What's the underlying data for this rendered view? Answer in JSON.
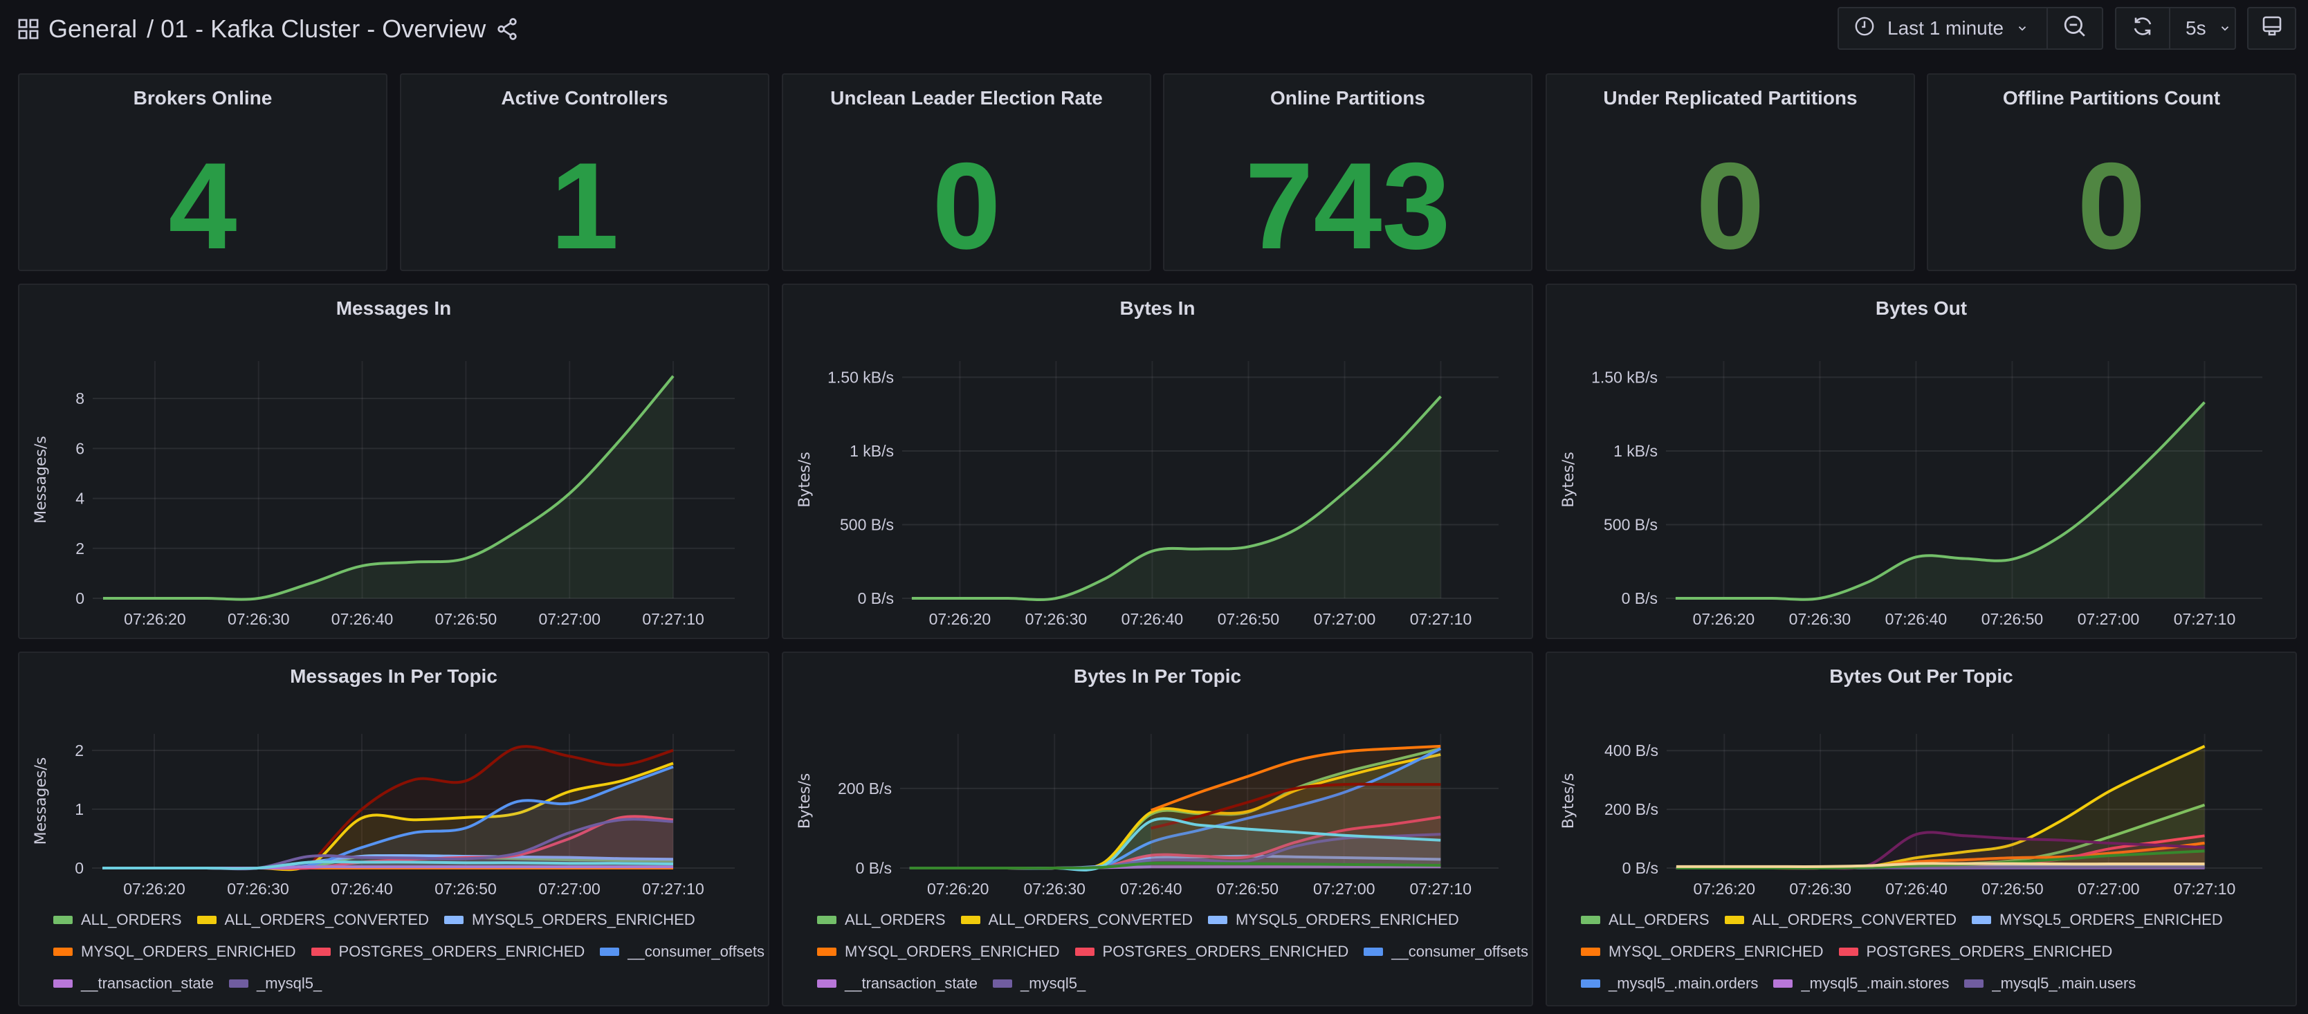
{
  "header": {
    "folder": "General",
    "title": "/ 01 - Kafka Cluster - Overview",
    "time_range": "Last 1 minute",
    "refresh_interval": "5s",
    "icons": [
      "dashboard-grid-icon",
      "share-icon",
      "clock-icon",
      "chevron-down-icon",
      "zoom-out-icon",
      "refresh-icon",
      "monitor-icon"
    ]
  },
  "colors": {
    "stat_green": "#299c46",
    "stat_green_dim": "#508642",
    "background": "#111217",
    "panel": "#181b1f"
  },
  "stats": [
    {
      "title": "Brokers Online",
      "value": "4",
      "color": "#299c46"
    },
    {
      "title": "Active Controllers",
      "value": "1",
      "color": "#299c46"
    },
    {
      "title": "Unclean Leader Election Rate",
      "value": "0",
      "color": "#299c46"
    },
    {
      "title": "Online Partitions",
      "value": "743",
      "color": "#299c46"
    },
    {
      "title": "Under Replicated Partitions",
      "value": "0",
      "color": "#508642"
    },
    {
      "title": "Offline Partitions Count",
      "value": "0",
      "color": "#508642"
    }
  ],
  "chart_data": [
    {
      "type": "line",
      "title": "Messages In",
      "ylabel": "Messages/s",
      "x": [
        "07:26:15",
        "07:26:20",
        "07:26:25",
        "07:26:30",
        "07:26:35",
        "07:26:40",
        "07:26:45",
        "07:26:50",
        "07:26:55",
        "07:27:00",
        "07:27:05",
        "07:27:10"
      ],
      "xlim": [
        "07:26:14",
        "07:27:15"
      ],
      "xticks": [
        "07:26:20",
        "07:26:30",
        "07:26:40",
        "07:26:50",
        "07:27:00",
        "07:27:10"
      ],
      "ylim": [
        0,
        9.5
      ],
      "yticks": [
        {
          "v": 0,
          "label": "0"
        },
        {
          "v": 2,
          "label": "2"
        },
        {
          "v": 4,
          "label": "4"
        },
        {
          "v": 6,
          "label": "6"
        },
        {
          "v": 8,
          "label": "8"
        }
      ],
      "grid": true,
      "series": [
        {
          "color": "#73bf69",
          "values": [
            0,
            0,
            0,
            0,
            0.6,
            1.3,
            1.45,
            1.6,
            2.7,
            4.2,
            6.4,
            8.9
          ]
        }
      ]
    },
    {
      "type": "line",
      "title": "Bytes In",
      "ylabel": "Bytes/s",
      "x": [
        "07:26:15",
        "07:26:20",
        "07:26:25",
        "07:26:30",
        "07:26:35",
        "07:26:40",
        "07:26:45",
        "07:26:50",
        "07:26:55",
        "07:27:00",
        "07:27:05",
        "07:27:10"
      ],
      "xlim": [
        "07:26:14",
        "07:27:15"
      ],
      "xticks": [
        "07:26:20",
        "07:26:30",
        "07:26:40",
        "07:26:50",
        "07:27:00",
        "07:27:10"
      ],
      "ylim": [
        0,
        1610
      ],
      "yticks": [
        {
          "v": 0,
          "label": "0 B/s"
        },
        {
          "v": 500,
          "label": "500 B/s"
        },
        {
          "v": 1000,
          "label": "1 kB/s"
        },
        {
          "v": 1500,
          "label": "1.50 kB/s"
        }
      ],
      "grid": true,
      "series": [
        {
          "color": "#73bf69",
          "values": [
            0,
            0,
            0,
            0,
            130,
            320,
            335,
            350,
            470,
            720,
            1020,
            1370
          ]
        }
      ]
    },
    {
      "type": "line",
      "title": "Bytes Out",
      "ylabel": "Bytes/s",
      "x": [
        "07:26:15",
        "07:26:20",
        "07:26:25",
        "07:26:30",
        "07:26:35",
        "07:26:40",
        "07:26:45",
        "07:26:50",
        "07:26:55",
        "07:27:00",
        "07:27:05",
        "07:27:10"
      ],
      "xlim": [
        "07:26:14",
        "07:27:15"
      ],
      "xticks": [
        "07:26:20",
        "07:26:30",
        "07:26:40",
        "07:26:50",
        "07:27:00",
        "07:27:10"
      ],
      "ylim": [
        0,
        1610
      ],
      "yticks": [
        {
          "v": 0,
          "label": "0 B/s"
        },
        {
          "v": 500,
          "label": "500 B/s"
        },
        {
          "v": 1000,
          "label": "1 kB/s"
        },
        {
          "v": 1500,
          "label": "1.50 kB/s"
        }
      ],
      "grid": true,
      "series": [
        {
          "color": "#73bf69",
          "values": [
            0,
            0,
            0,
            0,
            110,
            280,
            270,
            265,
            420,
            680,
            990,
            1330
          ]
        }
      ]
    },
    {
      "type": "line",
      "title": "Messages In Per Topic",
      "ylabel": "Messages/s",
      "legend": "bottom",
      "x": [
        "07:26:15",
        "07:26:20",
        "07:26:25",
        "07:26:30",
        "07:26:35",
        "07:26:40",
        "07:26:45",
        "07:26:50",
        "07:26:55",
        "07:27:00",
        "07:27:05",
        "07:27:10"
      ],
      "xlim": [
        "07:26:14",
        "07:27:15"
      ],
      "xticks": [
        "07:26:20",
        "07:26:30",
        "07:26:40",
        "07:26:50",
        "07:27:00",
        "07:27:10"
      ],
      "ylim": [
        0,
        2.28
      ],
      "yticks": [
        {
          "v": 0,
          "label": "0"
        },
        {
          "v": 1,
          "label": "1"
        },
        {
          "v": 2,
          "label": "2"
        }
      ],
      "grid": true,
      "series": [
        {
          "color": "#890f02",
          "values": [
            null,
            null,
            null,
            null,
            0.05,
            1.0,
            1.5,
            1.48,
            2.05,
            1.9,
            1.75,
            2.0
          ]
        },
        {
          "name": "ALL_ORDERS",
          "color": "#73bf69",
          "values": [
            0,
            0,
            0,
            0,
            0.02,
            0.2,
            0.19,
            0.18,
            0.16,
            0.14,
            0.13,
            0.12
          ]
        },
        {
          "name": "ALL_ORDERS_CONVERTED",
          "color": "#f2cc0c",
          "values": [
            0,
            0,
            0,
            0,
            0.05,
            0.85,
            0.82,
            0.86,
            0.93,
            1.3,
            1.48,
            1.78
          ]
        },
        {
          "name": "MYSQL5_ORDERS_ENRICHED",
          "color": "#8ab8ff",
          "values": [
            0,
            0,
            0,
            0,
            0.1,
            0.2,
            0.21,
            0.2,
            0.19,
            0.18,
            0.16,
            0.15
          ]
        },
        {
          "name": "MYSQL_ORDERS_ENRICHED",
          "color": "#ff780a",
          "values": [
            0,
            0,
            0,
            0,
            0,
            0,
            0,
            0,
            0,
            0,
            0,
            0
          ]
        },
        {
          "name": "POSTGRES_ORDERS_ENRICHED",
          "color": "#f2495c",
          "values": [
            0,
            0,
            0,
            0,
            0,
            0.1,
            0.15,
            0.18,
            0.22,
            0.5,
            0.86,
            0.82
          ]
        },
        {
          "name": "__consumer_offsets",
          "color": "#5794f2",
          "values": [
            0,
            0,
            0,
            0,
            0.05,
            0.35,
            0.6,
            0.68,
            1.13,
            1.1,
            1.4,
            1.72
          ]
        },
        {
          "name": "__transaction_state",
          "color": "#b877d9",
          "values": [
            0,
            0,
            0,
            0,
            0.02,
            0.02,
            0.02,
            0.02,
            0.02,
            0.02,
            0.02,
            0.02
          ]
        },
        {
          "name": "_mysql5_",
          "color": "#705da0",
          "values": [
            0,
            0,
            0,
            0,
            0.2,
            0.18,
            0.17,
            0.16,
            0.25,
            0.6,
            0.82,
            0.79
          ]
        },
        {
          "color": "#6ed0e0",
          "values": [
            0,
            0,
            0,
            0,
            0.1,
            0.1,
            0.1,
            0.09,
            0.09,
            0.08,
            0.08,
            0.07
          ]
        }
      ]
    },
    {
      "type": "line",
      "title": "Bytes In Per Topic",
      "ylabel": "Bytes/s",
      "legend": "bottom",
      "x": [
        "07:26:15",
        "07:26:20",
        "07:26:25",
        "07:26:30",
        "07:26:35",
        "07:26:40",
        "07:26:45",
        "07:26:50",
        "07:26:55",
        "07:27:00",
        "07:27:05",
        "07:27:10"
      ],
      "xlim": [
        "07:26:14",
        "07:27:15"
      ],
      "xticks": [
        "07:26:20",
        "07:26:30",
        "07:26:40",
        "07:26:50",
        "07:27:00",
        "07:27:10"
      ],
      "ylim": [
        0,
        337
      ],
      "yticks": [
        {
          "v": 0,
          "label": "0 B/s"
        },
        {
          "v": 200,
          "label": "200 B/s"
        }
      ],
      "grid": true,
      "series": [
        {
          "name": "ALL_ORDERS",
          "color": "#73bf69",
          "values": [
            0,
            0,
            0,
            0,
            10,
            135,
            137,
            140,
            200,
            240,
            270,
            300
          ]
        },
        {
          "name": "ALL_ORDERS_CONVERTED",
          "color": "#f2cc0c",
          "values": [
            0,
            0,
            0,
            0,
            12,
            140,
            140,
            142,
            195,
            230,
            260,
            285
          ]
        },
        {
          "name": "MYSQL5_ORDERS_ENRICHED",
          "color": "#8ab8ff",
          "values": [
            0,
            0,
            0,
            0,
            5,
            25,
            28,
            30,
            28,
            26,
            24,
            22
          ]
        },
        {
          "name": "MYSQL_ORDERS_ENRICHED",
          "color": "#ff780a",
          "values": [
            null,
            null,
            null,
            null,
            null,
            145,
            190,
            230,
            270,
            292,
            300,
            306
          ]
        },
        {
          "name": "POSTGRES_ORDERS_ENRICHED",
          "color": "#f2495c",
          "values": [
            0,
            0,
            0,
            0,
            3,
            32,
            30,
            28,
            65,
            95,
            110,
            128
          ]
        },
        {
          "name": "__consumer_offsets",
          "color": "#5794f2",
          "values": [
            0,
            0,
            0,
            0,
            5,
            65,
            95,
            125,
            155,
            190,
            240,
            300
          ]
        },
        {
          "name": "__transaction_state",
          "color": "#b877d9",
          "values": [
            0,
            0,
            0,
            0,
            1,
            3,
            3,
            3,
            3,
            3,
            3,
            3
          ]
        },
        {
          "name": "_mysql5_",
          "color": "#705da0",
          "values": [
            0,
            0,
            0,
            0,
            3,
            20,
            20,
            18,
            55,
            75,
            80,
            85
          ]
        },
        {
          "color": "#890f02",
          "values": [
            null,
            null,
            null,
            null,
            null,
            100,
            130,
            165,
            200,
            210,
            210,
            210
          ]
        },
        {
          "color": "#6ed0e0",
          "values": [
            0,
            0,
            0,
            0,
            5,
            118,
            108,
            98,
            90,
            82,
            76,
            70
          ]
        },
        {
          "color": "#37872d",
          "values": [
            0,
            0,
            0,
            0,
            2,
            12,
            12,
            11,
            10,
            9,
            8,
            7
          ]
        }
      ]
    },
    {
      "type": "line",
      "title": "Bytes Out Per Topic",
      "ylabel": "Bytes/s",
      "legend": "bottom",
      "x": [
        "07:26:15",
        "07:26:20",
        "07:26:25",
        "07:26:30",
        "07:26:35",
        "07:26:40",
        "07:26:45",
        "07:26:50",
        "07:26:55",
        "07:27:00",
        "07:27:05",
        "07:27:10"
      ],
      "xlim": [
        "07:26:14",
        "07:27:15"
      ],
      "xticks": [
        "07:26:20",
        "07:26:30",
        "07:26:40",
        "07:26:50",
        "07:27:00",
        "07:27:10"
      ],
      "ylim": [
        0,
        457
      ],
      "yticks": [
        {
          "v": 0,
          "label": "0 B/s"
        },
        {
          "v": 200,
          "label": "200 B/s"
        },
        {
          "v": 400,
          "label": "400 B/s"
        }
      ],
      "grid": true,
      "series": [
        {
          "name": "ALL_ORDERS",
          "color": "#73bf69",
          "values": [
            0,
            0,
            0,
            0,
            3,
            10,
            15,
            25,
            55,
            105,
            160,
            215
          ]
        },
        {
          "name": "ALL_ORDERS_CONVERTED",
          "color": "#f2cc0c",
          "values": [
            0,
            0,
            0,
            0,
            5,
            35,
            55,
            80,
            160,
            260,
            340,
            415
          ]
        },
        {
          "name": "MYSQL5_ORDERS_ENRICHED",
          "color": "#8ab8ff",
          "values": [
            0,
            0,
            0,
            0,
            2,
            8,
            8,
            8,
            8,
            8,
            8,
            8
          ]
        },
        {
          "name": "MYSQL_ORDERS_ENRICHED",
          "color": "#ff780a",
          "values": [
            0,
            0,
            0,
            0,
            5,
            22,
            28,
            35,
            38,
            50,
            65,
            85
          ]
        },
        {
          "name": "POSTGRES_ORDERS_ENRICHED",
          "color": "#f2495c",
          "values": [
            0,
            0,
            0,
            0,
            3,
            8,
            12,
            18,
            30,
            65,
            88,
            110
          ]
        },
        {
          "name": "_mysql5_.main.orders",
          "color": "#5794f2",
          "values": [
            0,
            0,
            0,
            0,
            1,
            2,
            2,
            2,
            2,
            2,
            2,
            2
          ]
        },
        {
          "name": "_mysql5_.main.stores",
          "color": "#b877d9",
          "values": [
            0,
            0,
            0,
            0,
            1,
            1,
            1,
            1,
            1,
            1,
            1,
            1
          ]
        },
        {
          "name": "_mysql5_.main.users",
          "color": "#705da0",
          "values": [
            0,
            0,
            0,
            0,
            1,
            3,
            3,
            3,
            3,
            3,
            3,
            3
          ]
        },
        {
          "color": "#6e1f5e",
          "values": [
            0,
            0,
            0,
            0,
            10,
            115,
            110,
            100,
            95,
            85,
            78,
            70
          ]
        },
        {
          "color": "#37872d",
          "values": [
            0,
            0,
            0,
            0,
            2,
            8,
            12,
            20,
            30,
            42,
            50,
            58
          ]
        },
        {
          "color": "#f4d598",
          "values": [
            5,
            5,
            5,
            5,
            8,
            15,
            15,
            15,
            14,
            14,
            14,
            14
          ]
        }
      ]
    }
  ]
}
